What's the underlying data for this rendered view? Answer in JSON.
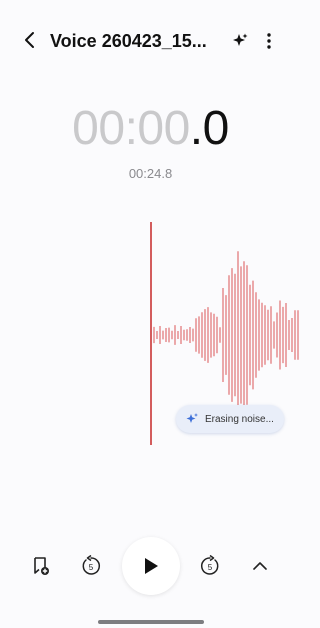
{
  "header": {
    "title": "Voice 260423_15...",
    "back_icon": "chevron-left-icon",
    "ai_icon": "sparkle-icon",
    "more_icon": "more-vertical-icon"
  },
  "timer": {
    "main_dim": "00:00",
    "main_bright": ".0",
    "total_duration": "00:24.8"
  },
  "waveform": {
    "color": "#d63a3a",
    "playhead_color": "#c62828"
  },
  "status_chip": {
    "icon": "sparkle-icon",
    "text": "Erasing noise..."
  },
  "controls": {
    "bookmark_icon": "bookmark-add-icon",
    "rewind_icon": "rewind-5-icon",
    "rewind_seconds": "5",
    "play_icon": "play-icon",
    "forward_icon": "forward-5-icon",
    "forward_seconds": "5",
    "expand_icon": "chevron-up-icon"
  }
}
